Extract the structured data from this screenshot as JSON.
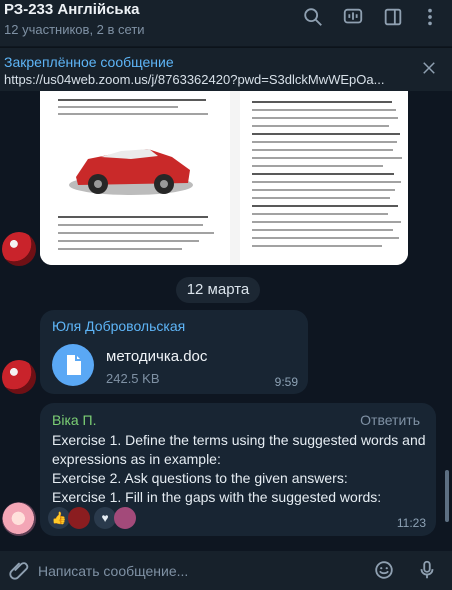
{
  "header": {
    "title": "РЗ-233 Англійська",
    "subtitle": "12 участников, 2 в сети",
    "icons": [
      "search-icon",
      "live-stream-icon",
      "sidebar-icon",
      "more-icon"
    ]
  },
  "pinned": {
    "title": "Закреплённое сообщение",
    "text": "https://us04web.zoom.us/j/8763362420?pwd=S3dlckMwWEpOa..."
  },
  "chat": {
    "date_label": "12 марта",
    "messages": [
      {
        "sender": "Юля Добровольская",
        "file_name": "методичка.doc",
        "file_size": "242.5 KB",
        "time": "9:59"
      },
      {
        "sender": "Віка П.",
        "reply_label": "Ответить",
        "lines": [
          "Exercise 1. Define the terms using the suggested words and",
          "expressions as in example:",
          "Exercise 2. Ask questions to the given answers:",
          "Exercise 1. Fill in the gaps with the suggested words:"
        ],
        "reactions": [
          {
            "emoji": "👍",
            "color": "#f2c14e"
          },
          {
            "emoji": "♥",
            "color": "#e5484d"
          }
        ],
        "time": "11:23"
      }
    ]
  },
  "composer": {
    "placeholder": "Написать сообщение..."
  }
}
